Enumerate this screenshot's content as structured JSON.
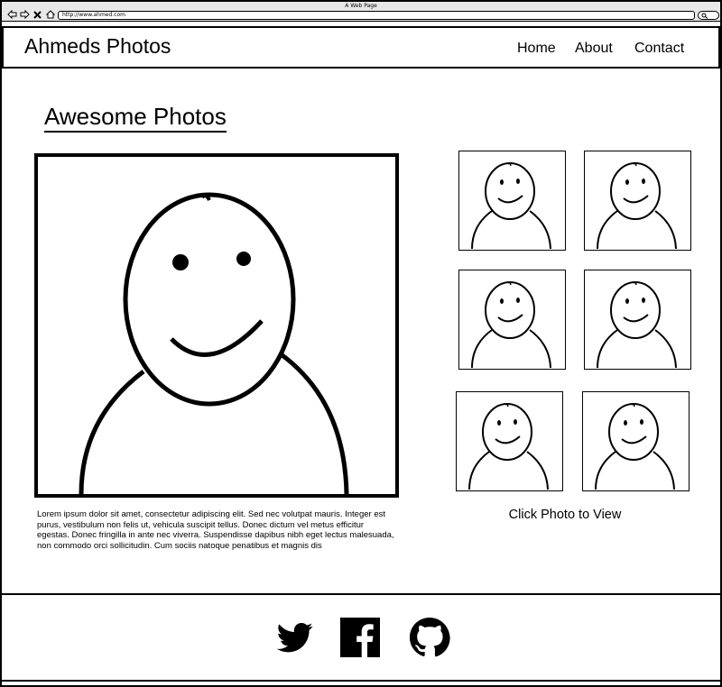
{
  "window": {
    "title": "A Web Page",
    "url": "http://www.ahmed.com"
  },
  "browser_controls": [
    {
      "name": "back-icon"
    },
    {
      "name": "forward-icon"
    },
    {
      "name": "close-icon"
    },
    {
      "name": "home-icon"
    }
  ],
  "header": {
    "site_title": "Ahmeds Photos",
    "nav": [
      "Home",
      "About",
      "Contact"
    ]
  },
  "main": {
    "heading": "Awesome Photos",
    "featured_photo_icon": "smiley-person-placeholder",
    "description": "Lorem ipsum dolor sit amet, consectetur adipiscing elit. Sed nec volutpat mauris. Integer est purus, vestibulum non felis ut, vehicula suscipit tellus. Donec dictum vel metus efficitur egestas. Donec fringilla in ante nec viverra. Suspendisse dapibus nibh eget lectus malesuada, non commodo orci sollicitudin. Cum sociis natoque penatibus et magnis dis",
    "thumbnail_count": 6,
    "thumbnail_icon": "smiley-person-placeholder",
    "caption": "Click Photo to View"
  },
  "footer": {
    "social_icons": [
      "twitter-icon",
      "facebook-icon",
      "github-icon"
    ]
  }
}
